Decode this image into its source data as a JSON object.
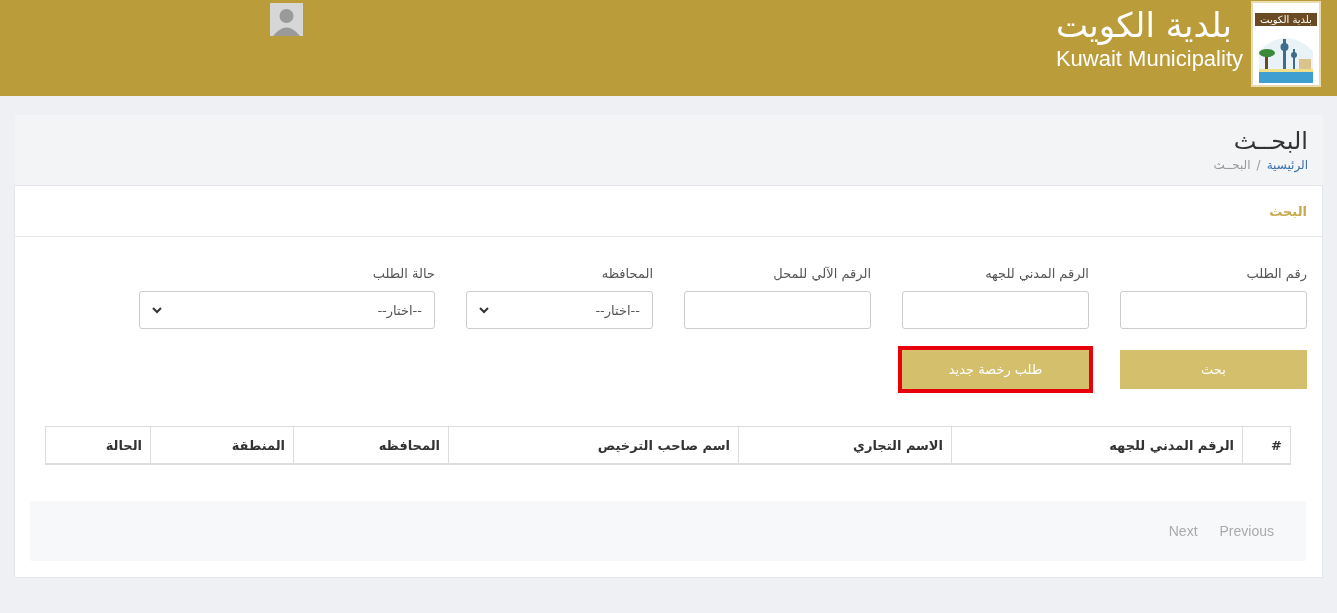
{
  "header": {
    "title_ar": "بلدية الكويت",
    "title_en": "Kuwait Municipality",
    "logo_badge": "بلدية الكويت"
  },
  "page": {
    "title": "البحــث",
    "separator": "/",
    "breadcrumb": [
      {
        "label": "الرئيسية",
        "kind": "link"
      },
      {
        "label": "البحــث",
        "kind": "current"
      }
    ]
  },
  "card": {
    "title": "البحث"
  },
  "fields": [
    {
      "label": "رقم الطلب",
      "kind": "text"
    },
    {
      "label": "الرقم المدني للجهه",
      "kind": "text"
    },
    {
      "label": "الرقم الآلي للمحل",
      "kind": "text"
    },
    {
      "label": "المحافظه",
      "kind": "select",
      "value": "--اختار--"
    },
    {
      "label": "حالة الطلب",
      "kind": "select",
      "value": "--اختار--"
    }
  ],
  "buttons": [
    {
      "label": "بحث",
      "highlighted": false
    },
    {
      "label": "طلب رخصة جديد",
      "highlighted": true
    }
  ],
  "table": {
    "columns": [
      "#",
      "الرقم المدني للجهه",
      "الاسم التجاري",
      "اسم صاحب الترخيص",
      "المحافظه",
      "المنطقة",
      "الحالة"
    ]
  },
  "pager": [
    {
      "label": "Previous",
      "disabled": true
    },
    {
      "label": "Next",
      "disabled": true
    }
  ]
}
